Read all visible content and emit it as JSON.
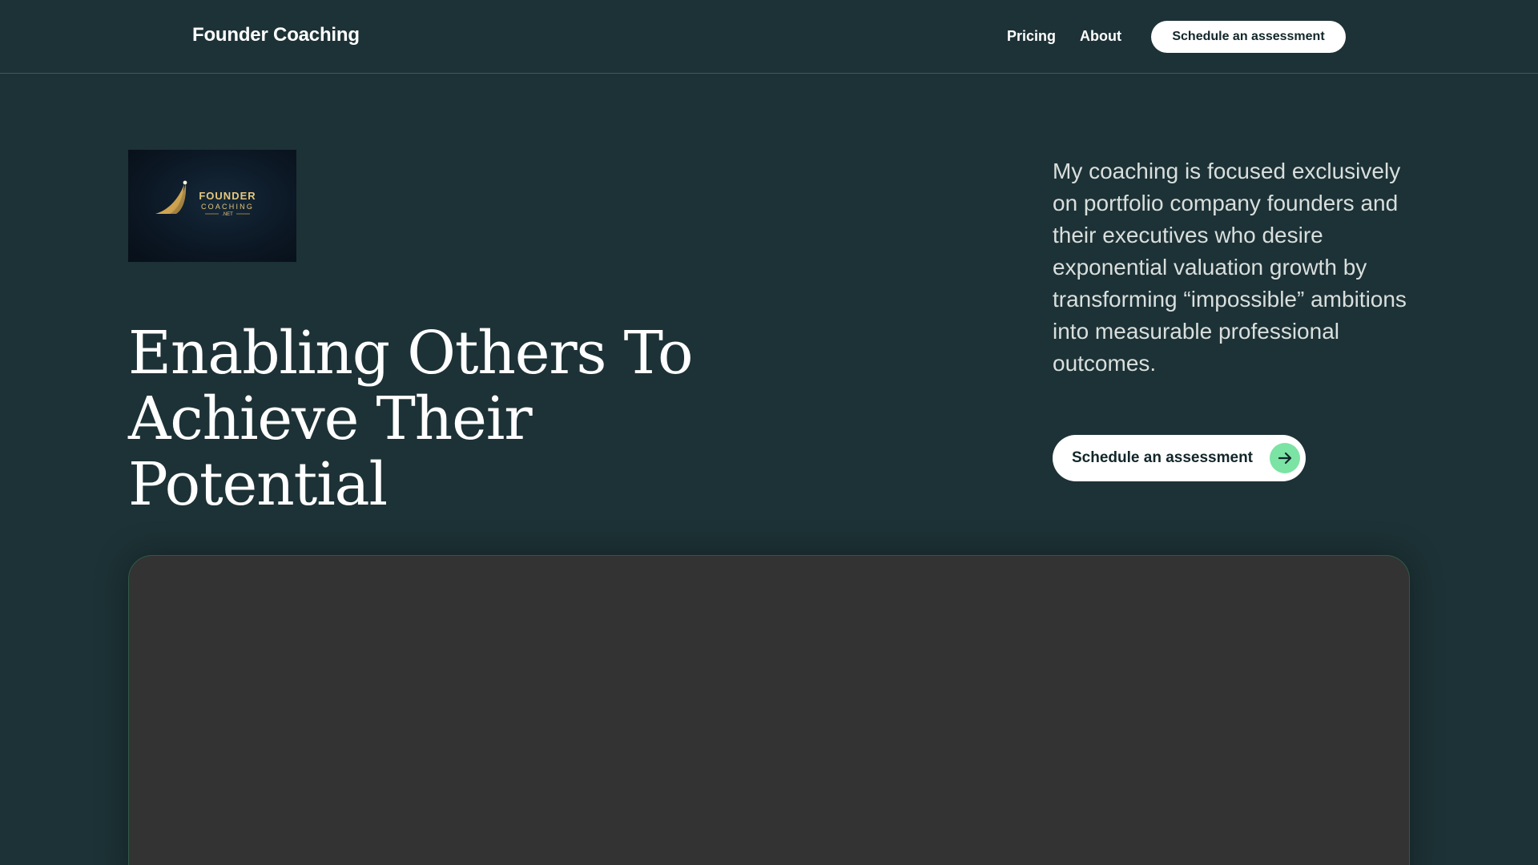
{
  "nav": {
    "brand": "Founder Coaching",
    "links": [
      {
        "label": "Pricing"
      },
      {
        "label": "About"
      }
    ],
    "cta_label": "Schedule an assessment"
  },
  "hero": {
    "logo": {
      "line1": "FOUNDER",
      "line2": "COACHING",
      "line3": ".NET"
    },
    "headline": "Enabling Others To Achieve Their Potential",
    "intro": "My coaching is focused exclusively on portfolio company founders and their executives who desire exponential valuation growth by transforming “impossible” ambitions into measurable professional outcomes.",
    "cta_label": "Schedule an assessment",
    "cta_icon": "arrow-right-icon"
  },
  "colors": {
    "background": "#1d3236",
    "accent": "#7be3a4",
    "button": "#ffffff",
    "panel": "#333333"
  }
}
